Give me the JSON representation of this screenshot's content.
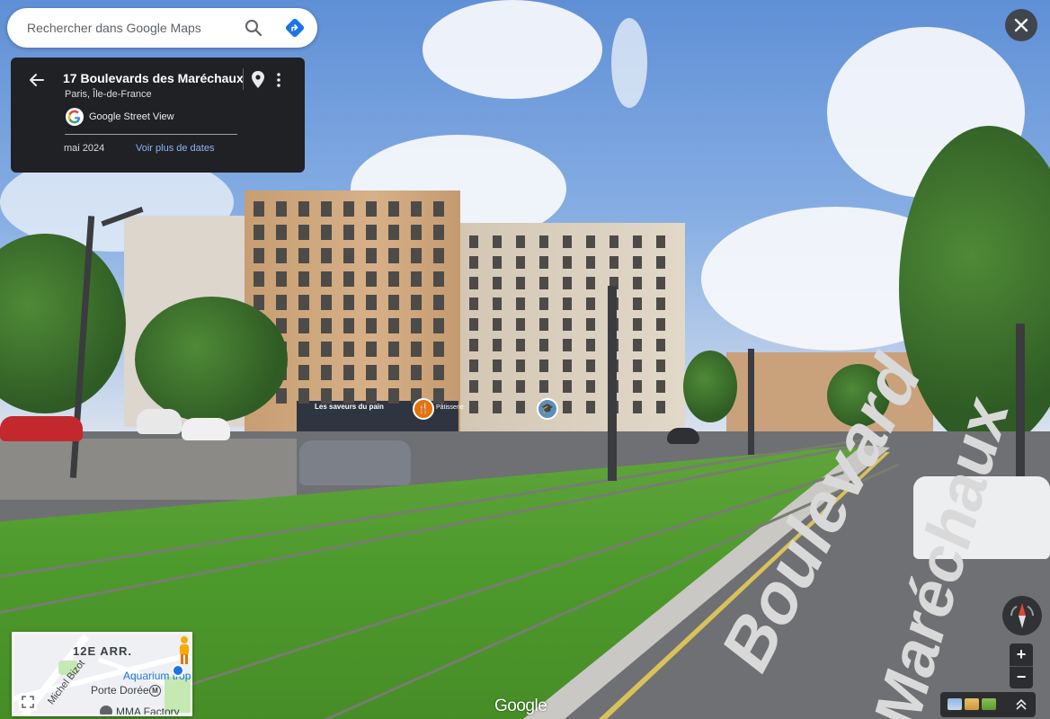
{
  "search": {
    "placeholder": "Rechercher dans Google Maps"
  },
  "place": {
    "title": "17 Boulevards des Maréchaux",
    "subtitle": "Paris, Île-de-France",
    "source": "Google Street View",
    "capture_date": "mai 2024",
    "more_dates_label": "Voir plus de dates"
  },
  "scene": {
    "shop_sign": "Les saveurs du pain",
    "shop_sign_2": "Pâtisserie",
    "road_text_1": "Boulevard",
    "road_text_2": "Maréchaux"
  },
  "minimap": {
    "district": "12E ARR.",
    "poi_1": "Aquarium tropic",
    "poi_2": "Porte Dorée",
    "street": "Michel Bizot",
    "poi_3": "MMA Factory"
  },
  "zoom": {
    "in_label": "+",
    "out_label": "−"
  },
  "brand": {
    "watermark": "Google"
  },
  "colors": {
    "card_bg": "#202124",
    "link": "#8ab4f8",
    "directions_blue": "#1a73e8",
    "compass_red": "#ea4335"
  },
  "icons": {
    "search": "magnifier-icon",
    "directions": "directions-diamond-icon",
    "back": "arrow-left-icon",
    "pin": "map-pin-icon",
    "more": "three-dots-vertical-icon",
    "close": "close-x-icon",
    "compass": "compass-icon",
    "expand": "fullscreen-icon",
    "pegman": "pegman-icon"
  }
}
